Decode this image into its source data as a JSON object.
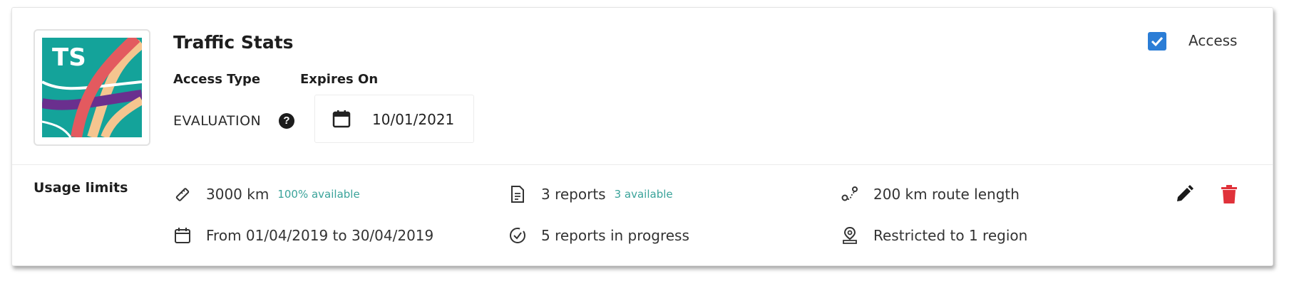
{
  "app": {
    "logo_text": "TS",
    "name": "Traffic Stats"
  },
  "access_type": {
    "label": "Access Type",
    "value": "EVALUATION",
    "help_icon": "question-circle-icon"
  },
  "expires": {
    "label": "Expires On",
    "value": "10/01/2021",
    "icon": "calendar-icon"
  },
  "access": {
    "label": "Access",
    "checked": true
  },
  "usage": {
    "title": "Usage limits",
    "items": [
      {
        "icon": "ruler-icon",
        "text": "3000 km",
        "badge": "100% available"
      },
      {
        "icon": "document-icon",
        "text": "3 reports",
        "badge": "3 available"
      },
      {
        "icon": "route-icon",
        "text": "200 km route length"
      },
      {
        "icon": "calendar-icon",
        "text": "From 01/04/2019 to 30/04/2019"
      },
      {
        "icon": "progress-check-icon",
        "text": "5 reports in progress"
      },
      {
        "icon": "location-pin-icon",
        "text": "Restricted to 1 region"
      }
    ]
  },
  "actions": {
    "edit_icon": "pencil-icon",
    "delete_icon": "trash-icon"
  },
  "colors": {
    "logo_bg": "#14a39a",
    "logo_purple": "#6a2f8e",
    "logo_coral": "#e35a5f",
    "logo_peach": "#f5c58f",
    "checkbox_blue": "#2b7dd6",
    "badge_teal": "#3aa39a",
    "delete_red": "#e0323a"
  }
}
